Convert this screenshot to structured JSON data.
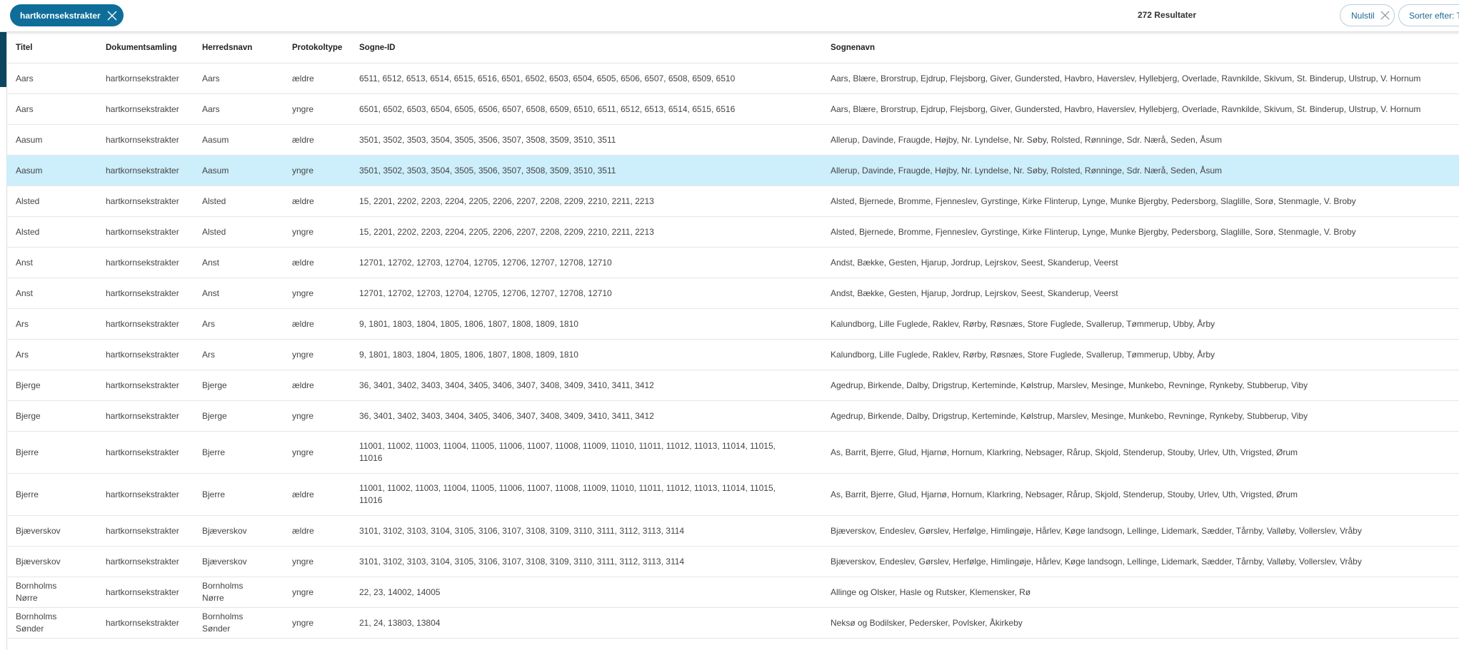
{
  "filter_chip": {
    "label": "hartkornsekstrakter"
  },
  "results": {
    "count_label": "272 Resultater"
  },
  "reset_button": {
    "label": "Nulstil"
  },
  "sort_button": {
    "label": "Sorter efter: T"
  },
  "table": {
    "columns": [
      "Titel",
      "Dokumentsamling",
      "Herredsnavn",
      "Protokoltype",
      "Sogne-ID",
      "Sognenavn"
    ],
    "selected_row": 3,
    "rows": [
      [
        "Aars",
        "hartkornsekstrakter",
        "Aars",
        "ældre",
        "6511, 6512, 6513, 6514, 6515, 6516, 6501, 6502, 6503, 6504, 6505, 6506, 6507, 6508, 6509, 6510",
        "Aars, Blære, Brorstrup, Ejdrup, Flejsborg, Giver, Gundersted, Havbro, Haverslev, Hyllebjerg, Overlade, Ravnkilde, Skivum, St. Binderup, Ulstrup, V. Hornum"
      ],
      [
        "Aars",
        "hartkornsekstrakter",
        "Aars",
        "yngre",
        "6501, 6502, 6503, 6504, 6505, 6506, 6507, 6508, 6509, 6510, 6511, 6512, 6513, 6514, 6515, 6516",
        "Aars, Blære, Brorstrup, Ejdrup, Flejsborg, Giver, Gundersted, Havbro, Haverslev, Hyllebjerg, Overlade, Ravnkilde, Skivum, St. Binderup, Ulstrup, V. Hornum"
      ],
      [
        "Aasum",
        "hartkornsekstrakter",
        "Aasum",
        "ældre",
        "3501, 3502, 3503, 3504, 3505, 3506, 3507, 3508, 3509, 3510, 3511",
        "Allerup, Davinde, Fraugde, Højby, Nr. Lyndelse, Nr. Søby, Rolsted, Rønninge, Sdr. Nærå, Seden, Åsum"
      ],
      [
        "Aasum",
        "hartkornsekstrakter",
        "Aasum",
        "yngre",
        "3501, 3502, 3503, 3504, 3505, 3506, 3507, 3508, 3509, 3510, 3511",
        "Allerup, Davinde, Fraugde, Højby, Nr. Lyndelse, Nr. Søby, Rolsted, Rønninge, Sdr. Nærå, Seden, Åsum"
      ],
      [
        "Alsted",
        "hartkornsekstrakter",
        "Alsted",
        "ældre",
        "15, 2201, 2202, 2203, 2204, 2205, 2206, 2207, 2208, 2209, 2210, 2211, 2213",
        "Alsted, Bjernede, Bromme, Fjenneslev, Gyrstinge, Kirke Flinterup, Lynge, Munke Bjergby, Pedersborg, Slaglille, Sorø, Stenmagle, V. Broby"
      ],
      [
        "Alsted",
        "hartkornsekstrakter",
        "Alsted",
        "yngre",
        "15, 2201, 2202, 2203, 2204, 2205, 2206, 2207, 2208, 2209, 2210, 2211, 2213",
        "Alsted, Bjernede, Bromme, Fjenneslev, Gyrstinge, Kirke Flinterup, Lynge, Munke Bjergby, Pedersborg, Slaglille, Sorø, Stenmagle, V. Broby"
      ],
      [
        "Anst",
        "hartkornsekstrakter",
        "Anst",
        "ældre",
        "12701, 12702, 12703, 12704, 12705, 12706, 12707, 12708, 12710",
        "Andst, Bække, Gesten, Hjarup, Jordrup, Lejrskov, Seest, Skanderup, Veerst"
      ],
      [
        "Anst",
        "hartkornsekstrakter",
        "Anst",
        "yngre",
        "12701, 12702, 12703, 12704, 12705, 12706, 12707, 12708, 12710",
        "Andst, Bække, Gesten, Hjarup, Jordrup, Lejrskov, Seest, Skanderup, Veerst"
      ],
      [
        "Ars",
        "hartkornsekstrakter",
        "Ars",
        "ældre",
        "9, 1801, 1803, 1804, 1805, 1806, 1807, 1808, 1809, 1810",
        "Kalundborg, Lille Fuglede, Raklev, Rørby, Røsnæs, Store Fuglede, Svallerup, Tømmerup, Ubby, Årby"
      ],
      [
        "Ars",
        "hartkornsekstrakter",
        "Ars",
        "yngre",
        "9, 1801, 1803, 1804, 1805, 1806, 1807, 1808, 1809, 1810",
        "Kalundborg, Lille Fuglede, Raklev, Rørby, Røsnæs, Store Fuglede, Svallerup, Tømmerup, Ubby, Årby"
      ],
      [
        "Bjerge",
        "hartkornsekstrakter",
        "Bjerge",
        "ældre",
        "36, 3401, 3402, 3403, 3404, 3405, 3406, 3407, 3408, 3409, 3410, 3411, 3412",
        "Agedrup, Birkende, Dalby, Drigstrup, Kerteminde, Kølstrup, Marslev, Mesinge, Munkebo, Revninge, Rynkeby, Stubberup, Viby"
      ],
      [
        "Bjerge",
        "hartkornsekstrakter",
        "Bjerge",
        "yngre",
        "36, 3401, 3402, 3403, 3404, 3405, 3406, 3407, 3408, 3409, 3410, 3411, 3412",
        "Agedrup, Birkende, Dalby, Drigstrup, Kerteminde, Kølstrup, Marslev, Mesinge, Munkebo, Revninge, Rynkeby, Stubberup, Viby"
      ],
      [
        "Bjerre",
        "hartkornsekstrakter",
        "Bjerre",
        "yngre",
        "11001, 11002, 11003, 11004, 11005, 11006, 11007, 11008, 11009, 11010, 11011, 11012, 11013, 11014, 11015, 11016",
        "As, Barrit, Bjerre, Glud, Hjarnø, Hornum, Klarkring, Nebsager, Rårup, Skjold, Stenderup, Stouby, Urlev, Uth, Vrigsted, Ørum"
      ],
      [
        "Bjerre",
        "hartkornsekstrakter",
        "Bjerre",
        "ældre",
        "11001, 11002, 11003, 11004, 11005, 11006, 11007, 11008, 11009, 11010, 11011, 11012, 11013, 11014, 11015, 11016",
        "As, Barrit, Bjerre, Glud, Hjarnø, Hornum, Klarkring, Nebsager, Rårup, Skjold, Stenderup, Stouby, Urlev, Uth, Vrigsted, Ørum"
      ],
      [
        "Bjæverskov",
        "hartkornsekstrakter",
        "Bjæverskov",
        "ældre",
        "3101, 3102, 3103, 3104, 3105, 3106, 3107, 3108, 3109, 3110, 3111, 3112, 3113, 3114",
        "Bjæverskov, Endeslev, Gørslev, Herfølge, Himlingøje, Hårlev, Køge landsogn, Lellinge, Lidemark, Sædder, Tårnby, Valløby, Vollerslev, Vråby"
      ],
      [
        "Bjæverskov",
        "hartkornsekstrakter",
        "Bjæverskov",
        "yngre",
        "3101, 3102, 3103, 3104, 3105, 3106, 3107, 3108, 3109, 3110, 3111, 3112, 3113, 3114",
        "Bjæverskov, Endeslev, Gørslev, Herfølge, Himlingøje, Hårlev, Køge landsogn, Lellinge, Lidemark, Sædder, Tårnby, Valløby, Vollerslev, Vråby"
      ],
      [
        "Bornholms Nørre",
        "hartkornsekstrakter",
        "Bornholms Nørre",
        "yngre",
        "22, 23, 14002, 14005",
        "Allinge og Olsker, Hasle og Rutsker, Klemensker, Rø"
      ],
      [
        "Bornholms Sønder",
        "hartkornsekstrakter",
        "Bornholms Sønder",
        "yngre",
        "21, 24, 13803, 13804",
        "Neksø og Bodilsker, Pedersker, Povlsker, Åkirkeby"
      ]
    ]
  }
}
